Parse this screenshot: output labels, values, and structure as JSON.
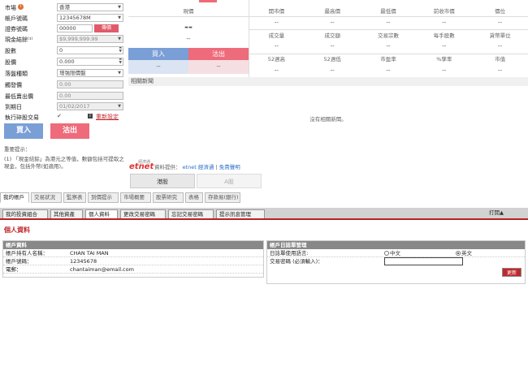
{
  "order_form": {
    "market": {
      "label": "市場",
      "value": "香港"
    },
    "account": {
      "label": "帳戶號碼",
      "value": "12345678M"
    },
    "password": {
      "label": "證券號碼",
      "value": "00000",
      "button": "傳價"
    },
    "cash": {
      "label": "現金結餘⁽¹⁾",
      "value": "$9,999,999.99"
    },
    "quantity": {
      "label": "股數",
      "value": "0"
    },
    "price": {
      "label": "股價",
      "value": "0.000"
    },
    "order_type": {
      "label": "落盤種類",
      "value": "增強限價盤"
    },
    "last_price": {
      "label": "觸發價",
      "value": "0.00"
    },
    "max_price": {
      "label": "最低賣出價",
      "value": "0.00"
    },
    "expiry": {
      "label": "到期日",
      "value": "01/02/2017"
    },
    "odd_lot": {
      "label": "執行碎股交易",
      "link": "重新設定"
    },
    "buy": "買入",
    "sell": "沽出",
    "notes_title": "重要提示：",
    "notes": "(1) 「現金結餘」為港元之等值，數額包括可提取之現金，包括外幣(如適用)。"
  },
  "quote": {
    "col1_header": "現價",
    "main_value": "--",
    "sub_value": "--",
    "headers_row1": [
      "開市價",
      "最高價",
      "最低價",
      "前收市價",
      "價位"
    ],
    "headers_row2": [
      "成交量",
      "成交額",
      "交易宗數",
      "每手股數",
      "貨幣單位"
    ],
    "headers_row3": [
      "52週高",
      "52週低",
      "市盈率",
      "%孳率",
      "市值"
    ],
    "dash": "--",
    "buy": "買入",
    "sell": "沽出"
  },
  "news": {
    "header": "相關新聞",
    "empty": "沒有相關新聞。"
  },
  "provider": {
    "small_text": "經濟通",
    "logo": "etnet",
    "label": "資料提供：",
    "link1": "etnet 經濟通",
    "separator": "|",
    "link2": "免責聲明"
  },
  "market_tabs": [
    "港股",
    "A股"
  ],
  "nav_tabs": [
    "我的帳戶",
    "交易狀況",
    "監察表",
    "到價提示",
    "市場概要",
    "股票研究",
    "表格",
    "存款易(銀行)"
  ],
  "sub_tabs": [
    "我的投資組合",
    "其他資產",
    "個人資料",
    "更改交易密碼",
    "忘記交易密碼",
    "提示訊息管理"
  ],
  "collapse": "打開▲",
  "page_title": "個人資料",
  "account_panel": {
    "title": "帳戶資料",
    "rows": [
      {
        "label": "帳戶持有人名稱：",
        "value": "CHAN TAI MAN"
      },
      {
        "label": "帳戶號碼：",
        "value": "12345678"
      },
      {
        "label": "電郵：",
        "value": "chantaiman@email.com"
      }
    ]
  },
  "settings_panel": {
    "title": "帳戶日誌單管理",
    "language_label": "日誌單使用語言:",
    "lang_options": [
      "中文",
      "英文"
    ],
    "selected_lang": "英文",
    "password_label": "交易密碼 (必須輸入)：",
    "update_button": "更新"
  },
  "colors": {
    "buy": "#7a9fd6",
    "sell": "#ee6b7b",
    "accent_red": "#c0282d"
  }
}
